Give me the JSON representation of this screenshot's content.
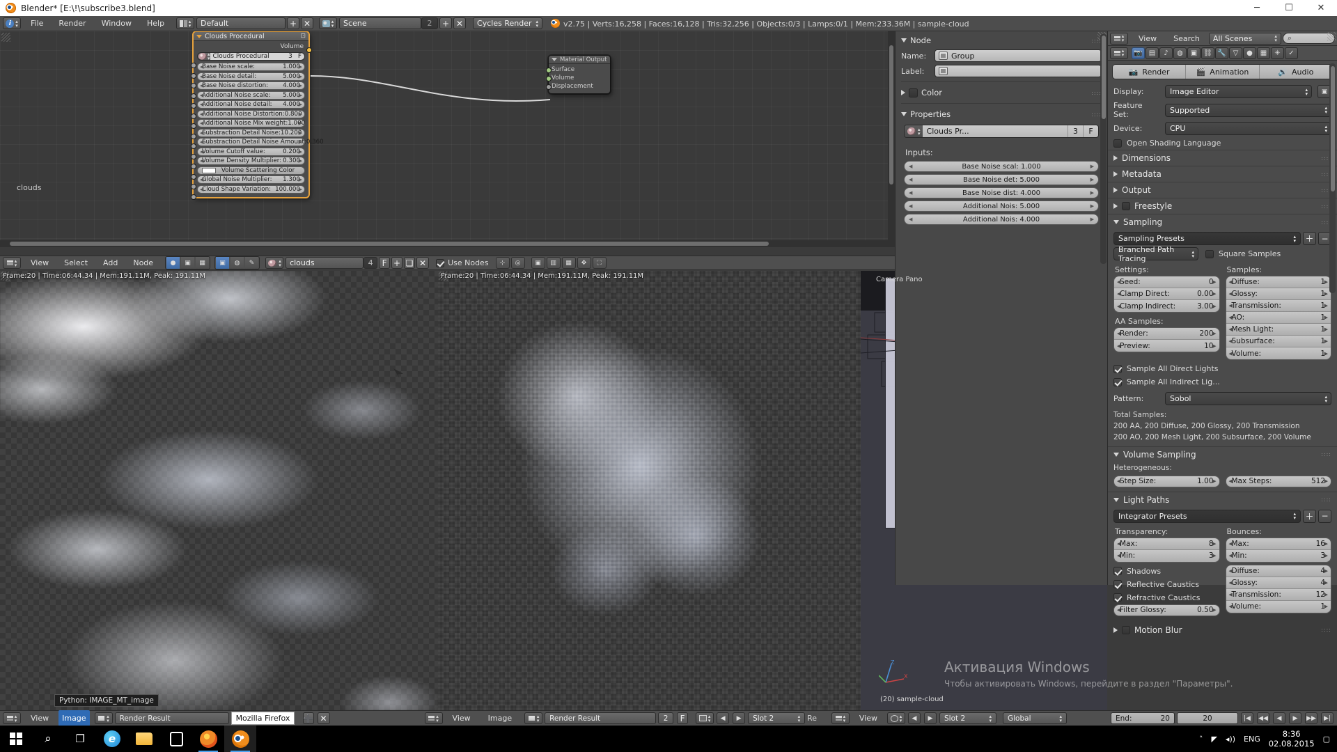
{
  "window": {
    "title": "Blender* [E:\\!\\subscribe3.blend]",
    "minimize": "─",
    "maximize": "☐",
    "close": "✕"
  },
  "info_header": {
    "editor_icon": "info-editor-icon",
    "menus": [
      "File",
      "Render",
      "Window",
      "Help"
    ],
    "screen_layout": "Default",
    "screen_layout_icon": "screen-layout-icon",
    "scene_name": "Scene",
    "scene_users": "2",
    "scene_icon": "scene-icon",
    "add_label": "+",
    "remove_label": "✕",
    "render_engine": "Cycles Render",
    "stats": "v2.75 | Verts:16,258 | Faces:16,128 | Tris:32,256 | Objects:0/3 | Lamps:0/1 | Mem:233.36M | sample-cloud"
  },
  "node_editor": {
    "footer_label": "clouds",
    "header": {
      "editor_icon": "node-editor-icon",
      "menus": [
        "View",
        "Select",
        "Add",
        "Node"
      ],
      "shader_type_icons": [
        "material-icon",
        "world-icon",
        "texture-icon"
      ],
      "context_icons": [
        "object-icon",
        "world-icon",
        "brush-icon"
      ],
      "datablock_icon": "material-icon",
      "datablock_name": "clouds",
      "users": "4",
      "fake_user": "F",
      "new_btn": "+",
      "close_btn": "✕",
      "use_nodes_label": "Use Nodes",
      "use_nodes_checked": true,
      "right_icons": [
        "snap-icon",
        "proportional-icon",
        "overlay-icon",
        "backdrop-icon",
        "grid-icon",
        "move-icon"
      ]
    },
    "group_node": {
      "title": "Clouds Procedural",
      "output_socket_label": "Volume",
      "group_select": "Clouds Procedural",
      "group_users": "3",
      "group_fake_user": "F",
      "inputs": [
        {
          "label": "Base Noise scale:",
          "value": "1.000"
        },
        {
          "label": "Base Noise detail:",
          "value": "5.000"
        },
        {
          "label": "Base Noise distortion:",
          "value": "4.000"
        },
        {
          "label": "Additional Noise scale:",
          "value": "5.000"
        },
        {
          "label": "Additional Noise detail:",
          "value": "4.000"
        },
        {
          "label": "Additional Noise Distortion:",
          "value": "0.800"
        },
        {
          "label": "Additional Noise Mix weight:",
          "value": "1.000"
        },
        {
          "label": "Substraction Detail Noise:",
          "value": "10.200"
        },
        {
          "label": "Substraction Detail Noise Amount:",
          "value": "0.360"
        },
        {
          "label": "Volume Cutoff value:",
          "value": "0.200"
        },
        {
          "label": "Volume Density Multiplier:",
          "value": "0.300"
        },
        {
          "label": "Volume Scattering Color",
          "value": ""
        },
        {
          "label": "Global Noise Multiplier:",
          "value": "1.300"
        },
        {
          "label": "Cloud Shape Variation:",
          "value": "100.000"
        }
      ]
    },
    "output_node": {
      "title": "Material Output",
      "inputs": [
        "Surface",
        "Volume",
        "Displacement"
      ]
    }
  },
  "node_properties": {
    "node_panel": "Node",
    "name_label": "Name:",
    "name_value": "Group",
    "label_label": "Label:",
    "label_value": "",
    "color_panel": "Color",
    "properties_panel": "Properties",
    "group_datablock": "Clouds Pr...",
    "group_users": "3",
    "group_fake_user": "F",
    "inputs_label": "Inputs:",
    "inputs": [
      "Base Noise scal: 1.000",
      "Base Noise det:  5.000",
      "Base Noise dist: 4.000",
      "Additional Nois: 5.000",
      "Additional Nois: 4.000"
    ]
  },
  "render_properties": {
    "header": {
      "editor_icon": "properties-editor-icon",
      "menus": [
        "View",
        "Search"
      ],
      "scope": "All Scenes",
      "search_icon": "search-icon",
      "search_placeholder": ""
    },
    "tabs": [
      {
        "icon": "render-camera-icon",
        "active": true
      },
      {
        "icon": "render-layers-icon",
        "active": false
      },
      {
        "icon": "scene-icon",
        "active": false
      },
      {
        "icon": "world-icon",
        "active": false
      },
      {
        "icon": "object-icon",
        "active": false
      },
      {
        "icon": "constraints-icon",
        "active": false
      },
      {
        "icon": "modifiers-wrench-icon",
        "active": false
      },
      {
        "icon": "data-mesh-icon",
        "active": false
      },
      {
        "icon": "material-icon",
        "active": false
      },
      {
        "icon": "texture-icon",
        "active": false
      },
      {
        "icon": "particles-icon",
        "active": false
      },
      {
        "icon": "physics-icon",
        "active": false
      }
    ],
    "render_buttons": [
      {
        "label": "Render",
        "icon": "camera-icon"
      },
      {
        "label": "Animation",
        "icon": "clapboard-icon"
      },
      {
        "label": "Audio",
        "icon": "speaker-icon"
      }
    ],
    "display_label": "Display:",
    "display_value": "Image Editor",
    "feature_set_label": "Feature Set:",
    "feature_set_value": "Supported",
    "device_label": "Device:",
    "device_value": "CPU",
    "osl_label": "Open Shading Language",
    "osl_checked": false,
    "collapsed_panels": [
      "Dimensions",
      "Metadata",
      "Output"
    ],
    "freestyle_label": "Freestyle",
    "freestyle_checked": false,
    "sampling": {
      "title": "Sampling",
      "presets_label": "Sampling Presets",
      "integrator": "Branched Path Tracing",
      "square_samples_label": "Square Samples",
      "square_samples_checked": false,
      "settings_label": "Settings:",
      "samples_label": "Samples:",
      "settings": [
        {
          "label": "Seed:",
          "value": "0"
        },
        {
          "label": "Clamp Direct:",
          "value": "0.00"
        },
        {
          "label": "Clamp Indirect:",
          "value": "3.00"
        }
      ],
      "aa_label": "AA Samples:",
      "aa": [
        {
          "label": "Render:",
          "value": "200"
        },
        {
          "label": "Preview:",
          "value": "10"
        }
      ],
      "samples": [
        {
          "label": "Diffuse:",
          "value": "1"
        },
        {
          "label": "Glossy:",
          "value": "1"
        },
        {
          "label": "Transmission:",
          "value": "1"
        },
        {
          "label": "AO:",
          "value": "1"
        },
        {
          "label": "Mesh Light:",
          "value": "1"
        },
        {
          "label": "Subsurface:",
          "value": "1"
        },
        {
          "label": "Volume:",
          "value": "1"
        }
      ],
      "sample_all_direct": "Sample All Direct Lights",
      "sample_all_direct_checked": true,
      "sample_all_indirect": "Sample All Indirect Lig...",
      "sample_all_indirect_checked": true,
      "pattern_label": "Pattern:",
      "pattern_value": "Sobol",
      "total_samples_label": "Total Samples:",
      "total_line1": "200 AA, 200 Diffuse, 200 Glossy, 200 Transmission",
      "total_line2": "200 AO, 200 Mesh Light, 200 Subsurface, 200 Volume"
    },
    "volume_sampling": {
      "title": "Volume Sampling",
      "heterogeneous_label": "Heterogeneous:",
      "step_size": {
        "label": "Step Size:",
        "value": "1.00"
      },
      "max_steps": {
        "label": "Max Steps:",
        "value": "512"
      }
    },
    "light_paths": {
      "title": "Light Paths",
      "presets_label": "Integrator Presets",
      "transparency_label": "Transparency:",
      "bounces_label": "Bounces:",
      "transparency": [
        {
          "label": "Max:",
          "value": "8"
        },
        {
          "label": "Min:",
          "value": "3"
        }
      ],
      "bounces": [
        {
          "label": "Max:",
          "value": "16"
        },
        {
          "label": "Min:",
          "value": "3"
        }
      ],
      "bounce_types": [
        {
          "label": "Diffuse:",
          "value": "4"
        },
        {
          "label": "Glossy:",
          "value": "4"
        },
        {
          "label": "Transmission:",
          "value": "12"
        },
        {
          "label": "Volume:",
          "value": "1"
        }
      ],
      "shadows_label": "Shadows",
      "shadows_checked": true,
      "reflective_caustics_label": "Reflective Caustics",
      "reflective_caustics_checked": true,
      "refractive_caustics_label": "Refractive Caustics",
      "refractive_caustics_checked": true,
      "filter_glossy": {
        "label": "Filter Glossy:",
        "value": "0.50"
      }
    },
    "motion_blur_label": "Motion Blur"
  },
  "image_editor_left": {
    "stamp": "Frame:20 | Time:06:44.34 | Mem:191.11M, Peak: 191.11M",
    "python_tooltip": "Python: IMAGE_MT_image"
  },
  "image_editor_mid": {
    "stamp": "Frame:20 | Time:06:44.34 | Mem:191.11M, Peak: 191.11M"
  },
  "viewport": {
    "view_name": "Camera Pano",
    "object_info": "(20) sample-cloud",
    "axis_x": "X",
    "axis_y": "Y",
    "axis_z": "Z"
  },
  "watermark": {
    "line1": "Активация Windows",
    "line2": "Чтобы активировать Windows, перейдите в раздел \"Параметры\"."
  },
  "bottom_headers": {
    "left": {
      "editor_icon": "image-editor-icon",
      "menus": [
        "View",
        "Image"
      ],
      "active_menu": "Image",
      "datablock_icon": "image-icon",
      "datablock": "Render Result",
      "firefox_tooltip": "Mozilla Firefox",
      "new_btn": "➕",
      "close_btn": "✕"
    },
    "mid": {
      "editor_icon": "image-editor-icon",
      "menus": [
        "View",
        "Image"
      ],
      "datablock_icon": "image-icon",
      "datablock": "Render Result",
      "users": "2",
      "fake_user": "F",
      "slot_icon": "render-slot-icon",
      "slot": "Slot 2",
      "extra": "Re"
    },
    "right": {
      "editor_icon": "view3d-editor-icon",
      "menus": [
        "View"
      ],
      "slot": "Slot 2",
      "pivot": "Global",
      "frame_current": "20",
      "frame_end": "20",
      "end_label": "End:",
      "nav_icons": [
        "jump-start-icon",
        "prev-keyframe-icon",
        "play-reverse-icon",
        "play-icon",
        "next-keyframe-icon",
        "jump-end-icon"
      ]
    }
  },
  "taskbar": {
    "items": [
      {
        "name": "start-button",
        "glyph": "⊞"
      },
      {
        "name": "search-icon",
        "glyph": "⚲"
      },
      {
        "name": "task-view-icon",
        "glyph": "⎕"
      },
      {
        "name": "edge-icon",
        "glyph": "e"
      },
      {
        "name": "file-explorer-icon",
        "glyph": "📁"
      },
      {
        "name": "store-icon",
        "glyph": "🛍"
      },
      {
        "name": "firefox-icon",
        "glyph": "◉"
      },
      {
        "name": "blender-icon",
        "glyph": "◉"
      }
    ],
    "tray": {
      "chevron": "˄",
      "network": "◰",
      "volume": "◂))",
      "lang": "ENG",
      "time": "8:36",
      "date": "02.08.2015",
      "notifications": "▢"
    }
  }
}
